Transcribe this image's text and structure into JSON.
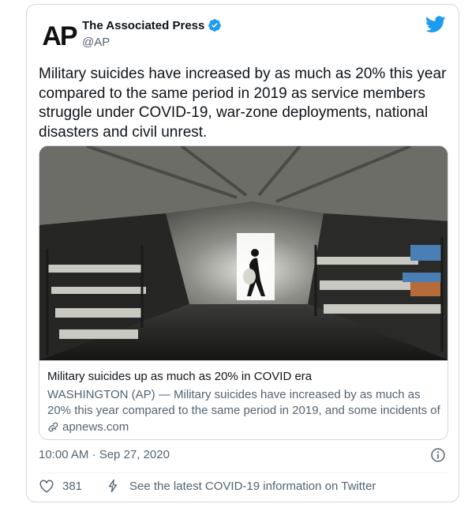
{
  "tweet": {
    "author": {
      "logo_text": "AP",
      "display_name": "The Associated Press",
      "handle": "@AP"
    },
    "text": "Military suicides have increased by as much as 20% this year compared to the same period in 2019 as service members struggle under COVID-19, war-zone deployments, national disasters and civil unrest.",
    "link_card": {
      "title": "Military suicides up as much as 20% in COVID era",
      "description": "WASHINGTON (AP) — Military suicides have increased by as much as 20% this year compared to the same period in 2019, and some incidents of ...",
      "domain": "apnews.com"
    },
    "timestamp": "10:00 AM · Sep 27, 2020",
    "likes": "381",
    "covid_info": "See the latest COVID-19 information on Twitter"
  },
  "colors": {
    "twitter_blue": "#1d9bf0",
    "secondary_text": "#536471",
    "border": "#cfd9de"
  },
  "icons": [
    "verified-badge-icon",
    "twitter-bird-icon",
    "link-icon",
    "info-icon",
    "heart-icon",
    "lightning-bolt-icon"
  ]
}
